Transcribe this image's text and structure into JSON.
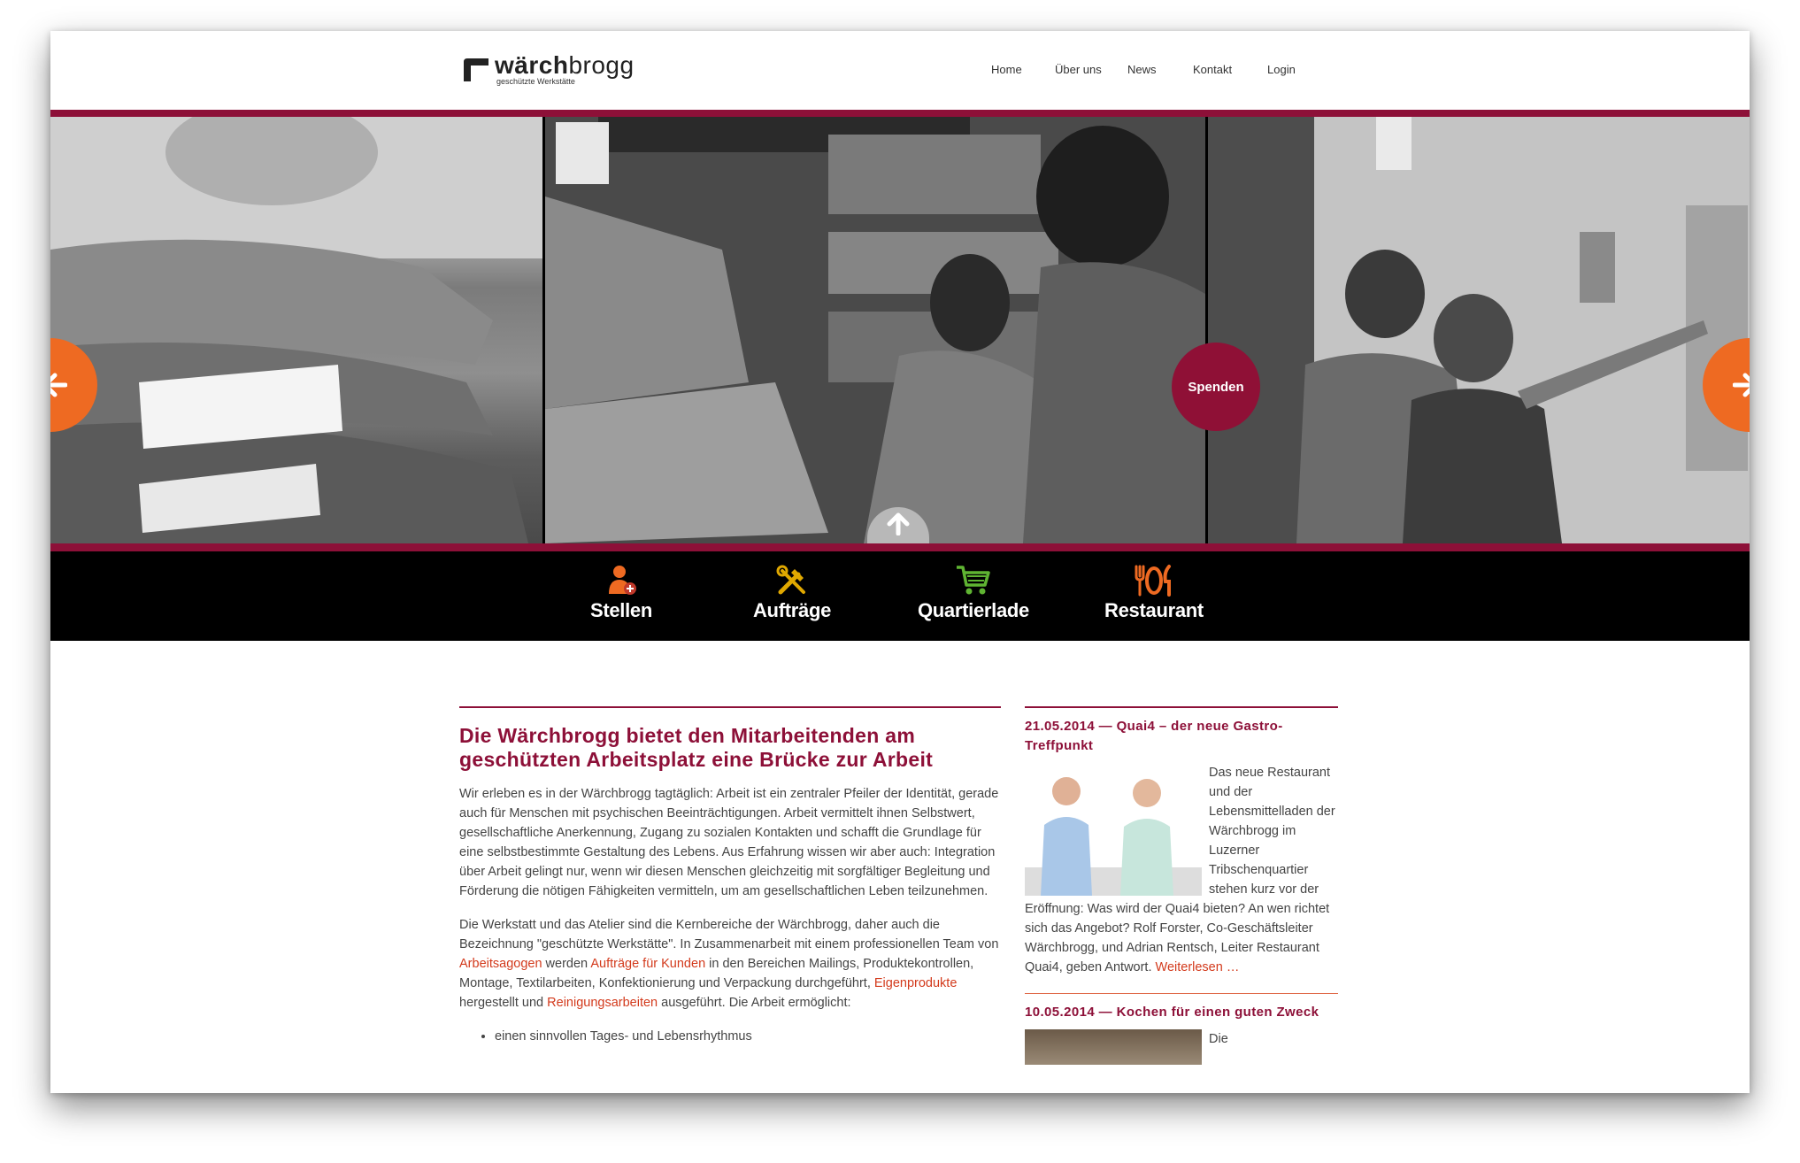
{
  "header": {
    "logo": {
      "word_bold": "wärch",
      "word_light": "brogg",
      "subtitle": "geschützte Werkstätte"
    },
    "nav": [
      "Home",
      "Über uns",
      "News",
      "Kontakt",
      "Login"
    ]
  },
  "slider": {
    "prev_icon": "arrow-left-icon",
    "next_icon": "arrow-right-icon",
    "donate_label": "Spenden",
    "up_icon": "arrow-up-icon",
    "accent_color": "#8d1038",
    "arrow_color": "#ee6a22"
  },
  "categories": [
    {
      "label": "Stellen",
      "icon": "person-add-icon",
      "color": "#ee6a22"
    },
    {
      "label": "Aufträge",
      "icon": "tools-icon",
      "color": "#e0a800"
    },
    {
      "label": "Quartierlade",
      "icon": "shopping-cart-icon",
      "color": "#5fb432"
    },
    {
      "label": "Restaurant",
      "icon": "cutlery-icon",
      "color": "#ee6a22"
    }
  ],
  "main": {
    "title": "Die Wärchbrogg bietet den Mitarbeitenden am geschützten Arbeitsplatz eine Brücke zur Arbeit",
    "para1": "Wir erleben es in der Wärchbrogg tagtäglich: Arbeit ist ein zentraler Pfeiler der Identität, gerade auch für Menschen mit psychischen Beeinträchtigungen. Arbeit vermittelt ihnen Selbstwert, gesellschaftliche Anerkennung, Zugang zu sozialen Kontakten und schafft die Grundlage für eine selbstbestimmte Gestaltung des Lebens. Aus Erfahrung wissen wir aber auch: Integration über Arbeit gelingt nur, wenn wir diesen Menschen gleichzeitig mit sorgfältiger Begleitung und Förderung die nötigen Fähigkeiten vermitteln, um am gesellschaftlichen Leben teilzunehmen.",
    "para2": {
      "t1": "Die Werkstatt und das Atelier sind die Kernbereiche der Wärchbrogg, daher auch die Bezeichnung \"geschützte Werkstätte\". In Zusammenarbeit mit einem professionellen Team von ",
      "link1": "Arbeitsagogen",
      "t2": " werden ",
      "link2": "Aufträge für Kunden",
      "t3": " in den Bereichen Mailings, Produktekontrollen, Montage, Textilarbeiten, Konfektionierung und Verpackung durchgeführt, ",
      "link3": "Eigenprodukte",
      "t4": " hergestellt und ",
      "link4": "Reinigungsarbeiten",
      "t5": " ausgeführt. Die Arbeit ermöglicht:"
    },
    "bullets": [
      "einen sinnvollen Tages- und Lebensrhythmus"
    ]
  },
  "news": [
    {
      "title": "21.05.2014 — Quai4 – der neue Gastro-Treffpunkt",
      "body": "Das neue Restaurant und der Lebensmittelladen der Wärchbrogg im Luzerner Tribschenquartier stehen kurz vor der Eröffnung: Was wird der Quai4 bieten? An wen richtet sich das Angebot? Rolf Forster, Co-Geschäftsleiter Wärchbrogg, und Adrian Rentsch, Leiter Restaurant Quai4, geben Antwort. ",
      "more": "Weiterlesen …"
    },
    {
      "title": "10.05.2014 — Kochen für einen guten Zweck",
      "body": "Die"
    }
  ]
}
